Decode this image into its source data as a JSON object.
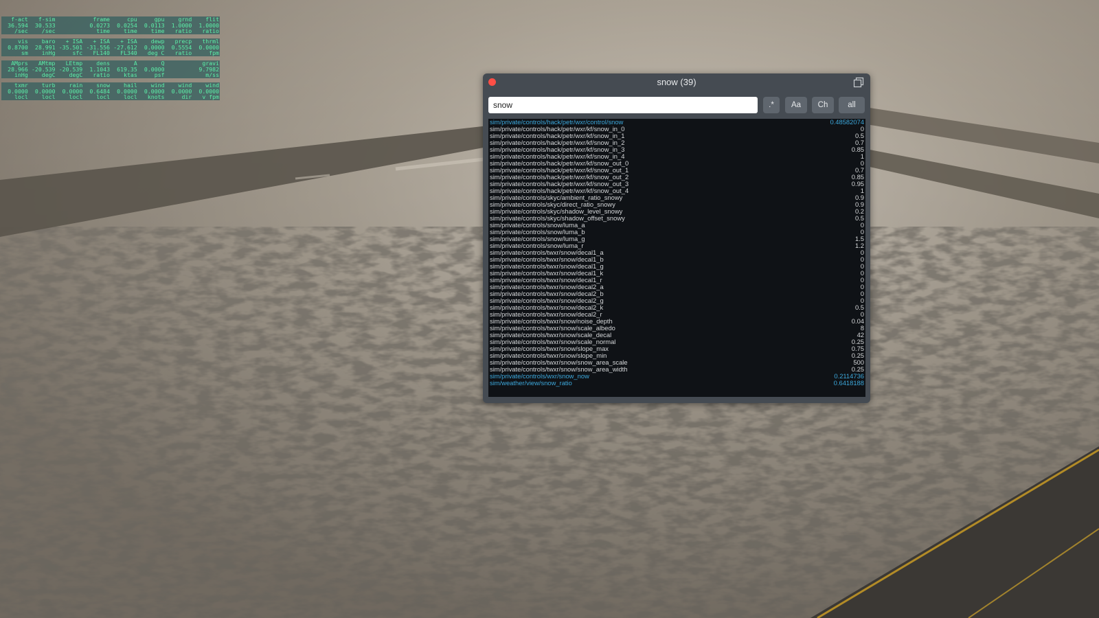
{
  "data_output": {
    "rows": [
      {
        "cells": [
          {
            "name": "f-act",
            "value": "36.594",
            "unit": "/sec"
          },
          {
            "name": "f-sim",
            "value": "30.533",
            "unit": "/sec"
          },
          {
            "name": "",
            "value": "",
            "unit": ""
          },
          {
            "name": "frame",
            "value": "0.0273",
            "unit": "time"
          },
          {
            "name": "cpu",
            "value": "0.0254",
            "unit": "time"
          },
          {
            "name": "gpu",
            "value": "0.0113",
            "unit": "time"
          },
          {
            "name": "grnd",
            "value": "1.0000",
            "unit": "ratio"
          },
          {
            "name": "flit",
            "value": "1.0000",
            "unit": "ratio"
          }
        ]
      },
      {
        "cells": [
          {
            "name": "vis",
            "value": "0.8700",
            "unit": "sm"
          },
          {
            "name": "baro",
            "value": "28.991",
            "unit": "inHg"
          },
          {
            "name": "+ ISA",
            "value": "-35.501",
            "unit": "sfc"
          },
          {
            "name": "+ ISA",
            "value": "-31.556",
            "unit": "FL140"
          },
          {
            "name": "+ ISA",
            "value": "-27.612",
            "unit": "FL340"
          },
          {
            "name": "dewp",
            "value": "0.0000",
            "unit": "deg C"
          },
          {
            "name": "precp",
            "value": "0.5554",
            "unit": "ratio"
          },
          {
            "name": "thrml",
            "value": "0.0000",
            "unit": "fpm"
          }
        ]
      },
      {
        "cells": [
          {
            "name": "AMprs",
            "value": "28.966",
            "unit": "inHg"
          },
          {
            "name": "AMtmp",
            "value": "-20.539",
            "unit": "degC"
          },
          {
            "name": "LEtmp",
            "value": "-20.539",
            "unit": "degC"
          },
          {
            "name": "dens",
            "value": "1.1043",
            "unit": "ratio"
          },
          {
            "name": "A",
            "value": "619.35",
            "unit": "ktas"
          },
          {
            "name": "Q",
            "value": "0.0000",
            "unit": "psf"
          },
          {
            "name": "",
            "value": "",
            "unit": ""
          },
          {
            "name": "gravi",
            "value": "9.7982",
            "unit": "m/ss"
          }
        ]
      },
      {
        "cells": [
          {
            "name": "txmr",
            "value": "0.0000",
            "unit": "locl"
          },
          {
            "name": "turb",
            "value": "0.0000",
            "unit": "locl"
          },
          {
            "name": "rain",
            "value": "0.0000",
            "unit": "locl"
          },
          {
            "name": "snow",
            "value": "0.6484",
            "unit": "locl"
          },
          {
            "name": "hail",
            "value": "0.0000",
            "unit": "locl"
          },
          {
            "name": "wind",
            "value": "0.0000",
            "unit": "knots"
          },
          {
            "name": "wind",
            "value": "0.0000",
            "unit": "dir"
          },
          {
            "name": "wind",
            "value": "0.0000",
            "unit": "v fpm"
          }
        ]
      }
    ]
  },
  "search_window": {
    "title": "snow (39)",
    "search": {
      "value": "snow",
      "placeholder": ""
    },
    "buttons": {
      "regex": ".*",
      "case": "Aa",
      "change": "Ch",
      "all": "all"
    },
    "results": [
      {
        "path": "sim/private/controls/hack/petr/wxr/control/snow",
        "value": "0.48582074",
        "changed": true
      },
      {
        "path": "sim/private/controls/hack/petr/wxr/kf/snow_in_0",
        "value": "0",
        "changed": false
      },
      {
        "path": "sim/private/controls/hack/petr/wxr/kf/snow_in_1",
        "value": "0.5",
        "changed": false
      },
      {
        "path": "sim/private/controls/hack/petr/wxr/kf/snow_in_2",
        "value": "0.7",
        "changed": false
      },
      {
        "path": "sim/private/controls/hack/petr/wxr/kf/snow_in_3",
        "value": "0.85",
        "changed": false
      },
      {
        "path": "sim/private/controls/hack/petr/wxr/kf/snow_in_4",
        "value": "1",
        "changed": false
      },
      {
        "path": "sim/private/controls/hack/petr/wxr/kf/snow_out_0",
        "value": "0",
        "changed": false
      },
      {
        "path": "sim/private/controls/hack/petr/wxr/kf/snow_out_1",
        "value": "0.7",
        "changed": false
      },
      {
        "path": "sim/private/controls/hack/petr/wxr/kf/snow_out_2",
        "value": "0.85",
        "changed": false
      },
      {
        "path": "sim/private/controls/hack/petr/wxr/kf/snow_out_3",
        "value": "0.95",
        "changed": false
      },
      {
        "path": "sim/private/controls/hack/petr/wxr/kf/snow_out_4",
        "value": "1",
        "changed": false
      },
      {
        "path": "sim/private/controls/skyc/ambient_ratio_snowy",
        "value": "0.9",
        "changed": false
      },
      {
        "path": "sim/private/controls/skyc/direct_ratio_snowy",
        "value": "0.9",
        "changed": false
      },
      {
        "path": "sim/private/controls/skyc/shadow_level_snowy",
        "value": "0.2",
        "changed": false
      },
      {
        "path": "sim/private/controls/skyc/shadow_offset_snowy",
        "value": "0.5",
        "changed": false
      },
      {
        "path": "sim/private/controls/snow/luma_a",
        "value": "0",
        "changed": false
      },
      {
        "path": "sim/private/controls/snow/luma_b",
        "value": "0",
        "changed": false
      },
      {
        "path": "sim/private/controls/snow/luma_g",
        "value": "1.5",
        "changed": false
      },
      {
        "path": "sim/private/controls/snow/luma_r",
        "value": "1.2",
        "changed": false
      },
      {
        "path": "sim/private/controls/twxr/snow/decal1_a",
        "value": "0",
        "changed": false
      },
      {
        "path": "sim/private/controls/twxr/snow/decal1_b",
        "value": "0",
        "changed": false
      },
      {
        "path": "sim/private/controls/twxr/snow/decal1_g",
        "value": "0",
        "changed": false
      },
      {
        "path": "sim/private/controls/twxr/snow/decal1_k",
        "value": "0",
        "changed": false
      },
      {
        "path": "sim/private/controls/twxr/snow/decal1_r",
        "value": "0",
        "changed": false
      },
      {
        "path": "sim/private/controls/twxr/snow/decal2_a",
        "value": "0",
        "changed": false
      },
      {
        "path": "sim/private/controls/twxr/snow/decal2_b",
        "value": "0",
        "changed": false
      },
      {
        "path": "sim/private/controls/twxr/snow/decal2_g",
        "value": "0",
        "changed": false
      },
      {
        "path": "sim/private/controls/twxr/snow/decal2_k",
        "value": "0.5",
        "changed": false
      },
      {
        "path": "sim/private/controls/twxr/snow/decal2_r",
        "value": "0",
        "changed": false
      },
      {
        "path": "sim/private/controls/twxr/snow/noise_depth",
        "value": "0.04",
        "changed": false
      },
      {
        "path": "sim/private/controls/twxr/snow/scale_albedo",
        "value": "8",
        "changed": false
      },
      {
        "path": "sim/private/controls/twxr/snow/scale_decal",
        "value": "42",
        "changed": false
      },
      {
        "path": "sim/private/controls/twxr/snow/scale_normal",
        "value": "0.25",
        "changed": false
      },
      {
        "path": "sim/private/controls/twxr/snow/slope_max",
        "value": "0.75",
        "changed": false
      },
      {
        "path": "sim/private/controls/twxr/snow/slope_min",
        "value": "0.25",
        "changed": false
      },
      {
        "path": "sim/private/controls/twxr/snow/snow_area_scale",
        "value": "500",
        "changed": false
      },
      {
        "path": "sim/private/controls/twxr/snow/snow_area_width",
        "value": "0.25",
        "changed": false
      },
      {
        "path": "sim/private/controls/wxr/snow_now",
        "value": "0.2114736",
        "changed": true
      },
      {
        "path": "sim/weather/view/snow_ratio",
        "value": "0.6418188",
        "changed": true
      }
    ]
  },
  "colors": {
    "window_bg": "#454b52",
    "results_bg": "#0f1216",
    "changed_value": "#3da9dd",
    "data_output_text": "#5cf0a8",
    "close_button": "#ff4f46"
  },
  "icons": {
    "close": "close-icon",
    "popout": "popout-window-icon"
  }
}
